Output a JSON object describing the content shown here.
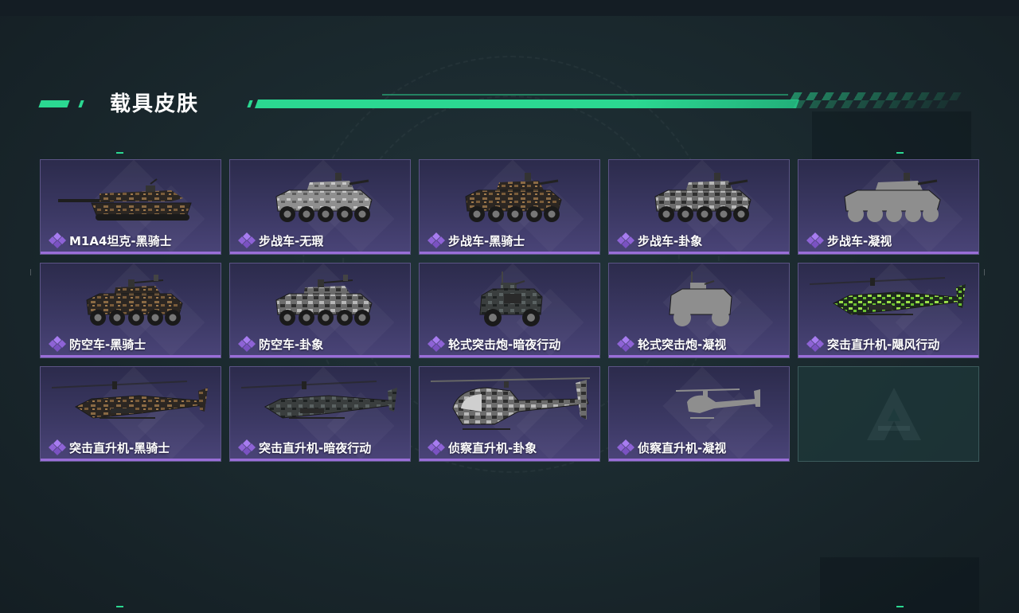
{
  "header": {
    "title": "载具皮肤"
  },
  "colors": {
    "accent": "#2bd891",
    "card_bg": "#3b3863",
    "card_border": "#5c5486",
    "card_bottom": "#9a6ed8",
    "empty_bg": "#1e3a3c"
  },
  "skins": [
    {
      "name": "M1A4坦克-黑骑士",
      "vehicle": "tank",
      "camo": "black-knight"
    },
    {
      "name": "步战车-无瑕",
      "vehicle": "ifv",
      "camo": "flawless"
    },
    {
      "name": "步战车-黑骑士",
      "vehicle": "ifv",
      "camo": "black-knight"
    },
    {
      "name": "步战车-卦象",
      "vehicle": "ifv",
      "camo": "hexagram"
    },
    {
      "name": "步战车-凝视",
      "vehicle": "ifv",
      "camo": "locked"
    },
    {
      "name": "防空车-黑骑士",
      "vehicle": "aa",
      "camo": "black-knight"
    },
    {
      "name": "防空车-卦象",
      "vehicle": "aa",
      "camo": "hexagram"
    },
    {
      "name": "轮式突击炮-暗夜行动",
      "vehicle": "armored-car",
      "camo": "night-ops"
    },
    {
      "name": "轮式突击炮-凝视",
      "vehicle": "armored-car",
      "camo": "locked"
    },
    {
      "name": "突击直升机-飓风行动",
      "vehicle": "attack-heli",
      "camo": "hurricane"
    },
    {
      "name": "突击直升机-黑骑士",
      "vehicle": "attack-heli",
      "camo": "black-knight"
    },
    {
      "name": "突击直升机-暗夜行动",
      "vehicle": "attack-heli",
      "camo": "night-ops"
    },
    {
      "name": "侦察直升机-卦象",
      "vehicle": "scout-heli",
      "camo": "hexagram"
    },
    {
      "name": "侦察直升机-凝视",
      "vehicle": "scout-heli",
      "camo": "locked"
    }
  ],
  "empty_slot": {
    "icon": "game-logo-icon"
  }
}
